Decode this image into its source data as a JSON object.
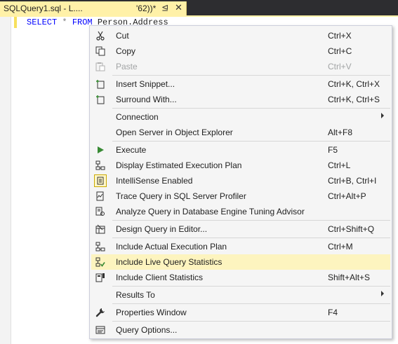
{
  "tab": {
    "title": "SQLQuery1.sql - L....",
    "title_suffix": "'62))*",
    "pin_icon": "pin-icon",
    "close_icon": "close-icon"
  },
  "code": {
    "select": "SELECT",
    "star": "*",
    "from": "FROM",
    "table": "Person.Address"
  },
  "menu": {
    "cut": {
      "label": "Cut",
      "shortcut": "Ctrl+X"
    },
    "copy": {
      "label": "Copy",
      "shortcut": "Ctrl+C"
    },
    "paste": {
      "label": "Paste",
      "shortcut": "Ctrl+V"
    },
    "insert_snippet": {
      "label": "Insert Snippet...",
      "shortcut": "Ctrl+K, Ctrl+X"
    },
    "surround_with": {
      "label": "Surround With...",
      "shortcut": "Ctrl+K, Ctrl+S"
    },
    "connection": {
      "label": "Connection"
    },
    "open_server": {
      "label": "Open Server in Object Explorer",
      "shortcut": "Alt+F8"
    },
    "execute": {
      "label": "Execute",
      "shortcut": "F5"
    },
    "display_plan": {
      "label": "Display Estimated Execution Plan",
      "shortcut": "Ctrl+L"
    },
    "intellisense": {
      "label": "IntelliSense Enabled",
      "shortcut": "Ctrl+B, Ctrl+I"
    },
    "trace_query": {
      "label": "Trace Query in SQL Server Profiler",
      "shortcut": "Ctrl+Alt+P"
    },
    "analyze_query": {
      "label": "Analyze Query in Database Engine Tuning Advisor"
    },
    "design_query": {
      "label": "Design Query in Editor...",
      "shortcut": "Ctrl+Shift+Q"
    },
    "actual_plan": {
      "label": "Include Actual Execution Plan",
      "shortcut": "Ctrl+M"
    },
    "live_stats": {
      "label": "Include Live Query Statistics"
    },
    "client_stats": {
      "label": "Include Client Statistics",
      "shortcut": "Shift+Alt+S"
    },
    "results_to": {
      "label": "Results To"
    },
    "properties": {
      "label": "Properties Window",
      "shortcut": "F4"
    },
    "query_options": {
      "label": "Query Options..."
    }
  },
  "colors": {
    "highlight": "#fdf4bf",
    "tab_active": "#fff1a8",
    "keyword": "#0000ff",
    "execute_green": "#388a34"
  }
}
